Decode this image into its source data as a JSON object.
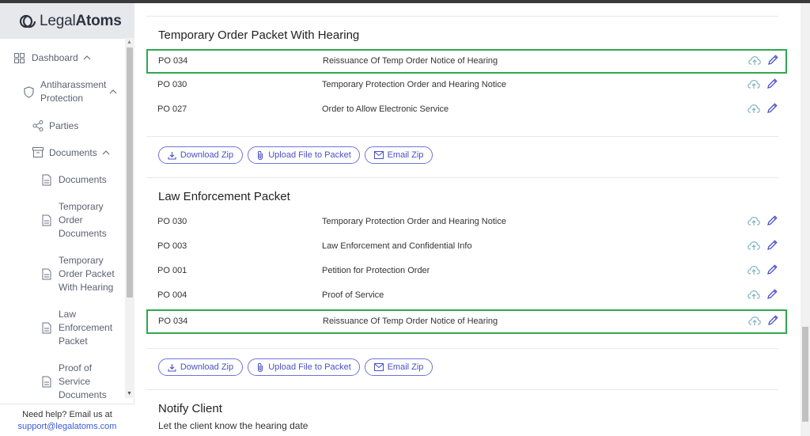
{
  "app": {
    "logo_light": "Legal",
    "logo_bold": "Atoms"
  },
  "sidebar": {
    "dashboard": "Dashboard",
    "antiharassment_line1": "Antiharassment",
    "antiharassment_line2": "Protection",
    "parties": "Parties",
    "documents_group": "Documents",
    "documents": "Documents",
    "temp_order_1": "Temporary",
    "temp_order_2": "Order",
    "temp_order_3": "Documents",
    "temp_packet_1": "Temporary",
    "temp_packet_2": "Order Packet",
    "temp_packet_3": "With Hearing",
    "law_1": "Law",
    "law_2": "Enforcement",
    "law_3": "Packet",
    "proof_1": "Proof of",
    "proof_2": "Service",
    "proof_3": "Documents"
  },
  "help": {
    "text": "Need help? Email us at",
    "email": "support@legalatoms.com"
  },
  "temp_packet": {
    "title": "Temporary Order Packet With Hearing",
    "rows": [
      {
        "code": "PO 034",
        "name": "Reissuance Of Temp Order Notice of Hearing"
      },
      {
        "code": "PO 030",
        "name": "Temporary Protection Order and Hearing Notice"
      },
      {
        "code": "PO 027",
        "name": "Order to Allow Electronic Service"
      }
    ]
  },
  "law_packet": {
    "title": "Law Enforcement Packet",
    "rows": [
      {
        "code": "PO 030",
        "name": "Temporary Protection Order and Hearing Notice"
      },
      {
        "code": "PO 003",
        "name": "Law Enforcement and Confidential Info"
      },
      {
        "code": "PO 001",
        "name": "Petition for Protection Order"
      },
      {
        "code": "PO 004",
        "name": "Proof of Service"
      },
      {
        "code": "PO 034",
        "name": "Reissuance Of Temp Order Notice of Hearing"
      }
    ]
  },
  "actions": {
    "download": "Download Zip",
    "upload": "Upload File to Packet",
    "email": "Email Zip"
  },
  "notify": {
    "title": "Notify Client",
    "subtitle": "Let the client know the hearing date"
  },
  "colors": {
    "accent": "#4b4fc7",
    "highlight": "#2fa84f",
    "upload_icon": "#7fb3c4"
  }
}
